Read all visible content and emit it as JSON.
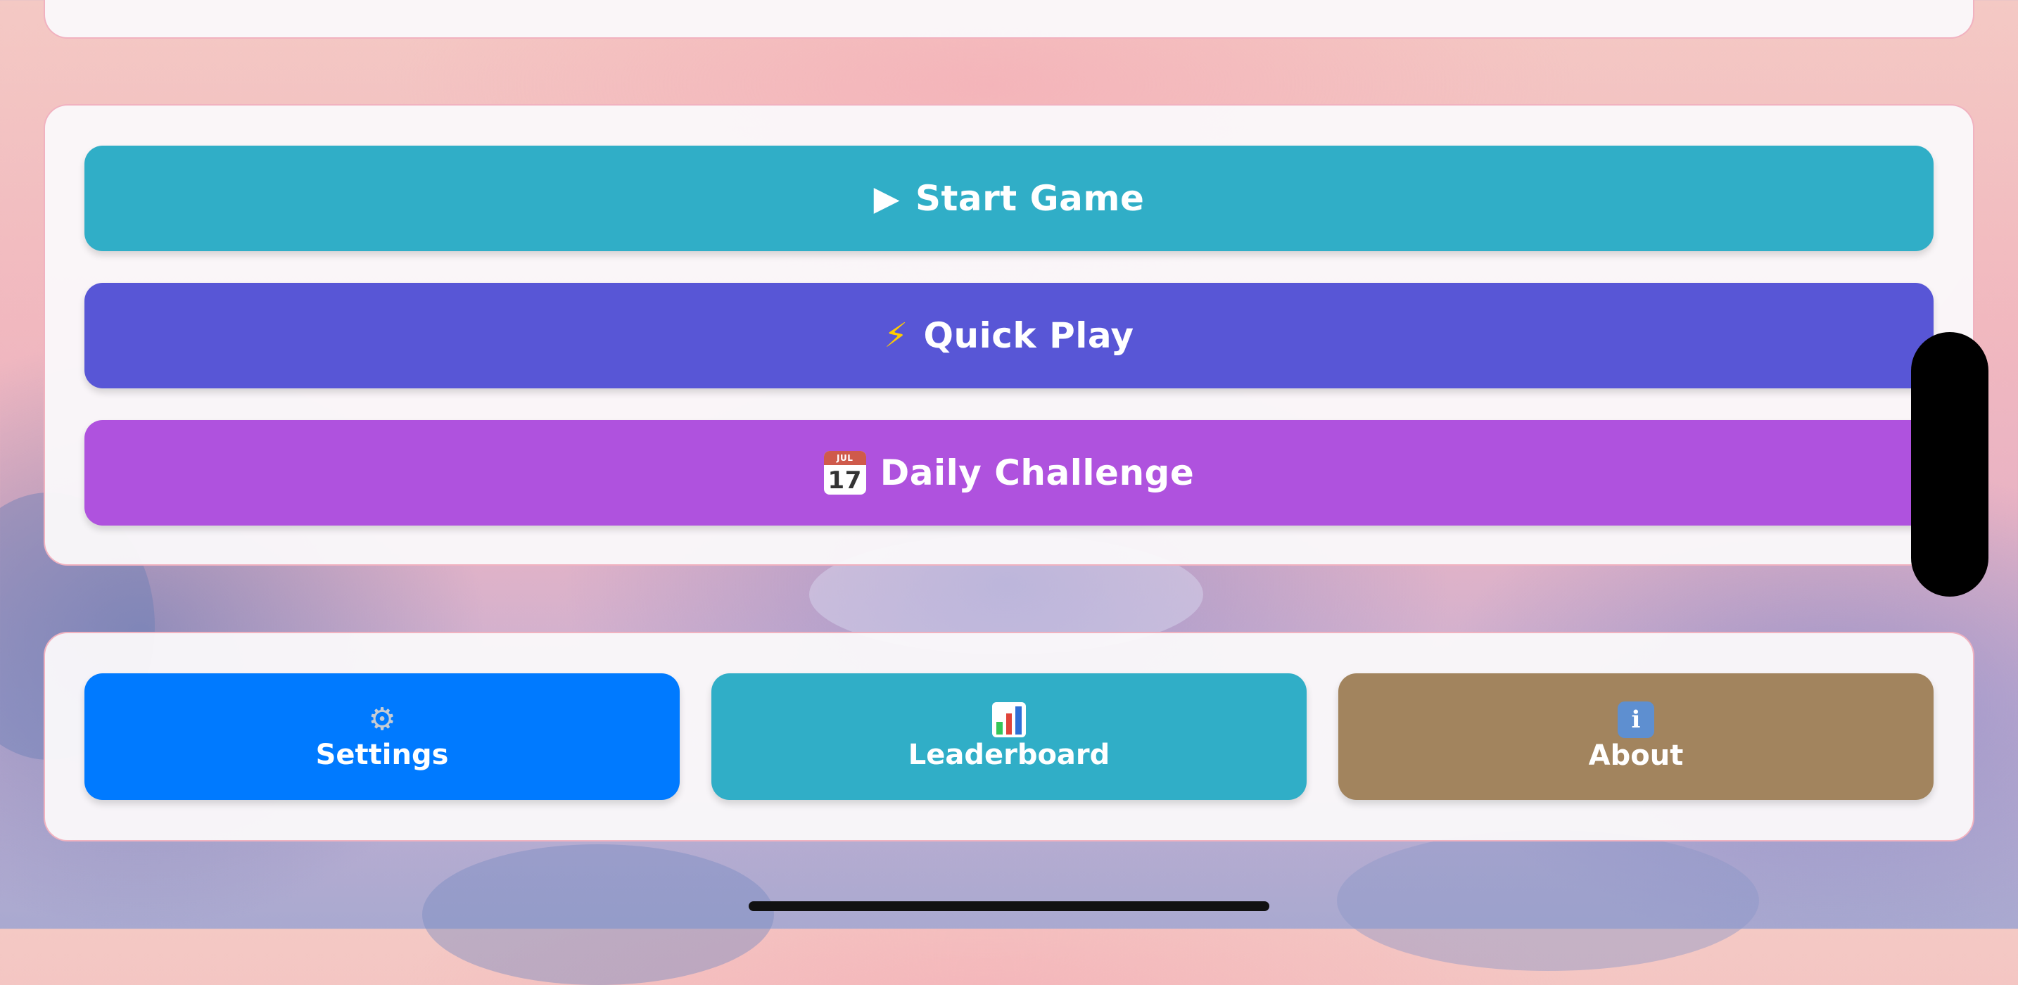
{
  "menu": {
    "start_game": {
      "icon": "play-icon",
      "glyph": "▶",
      "label": "Start Game",
      "color": "#30AEC7"
    },
    "quick_play": {
      "icon": "lightning-icon",
      "glyph": "⚡",
      "label": "Quick Play",
      "color": "#5856D6"
    },
    "daily_challenge": {
      "icon": "calendar-icon",
      "calendar_month": "JUL",
      "calendar_day": "17",
      "label": "Daily Challenge",
      "color": "#AF52DE"
    }
  },
  "nav": {
    "settings": {
      "icon": "gear-icon",
      "glyph": "⚙",
      "label": "Settings",
      "color": "#007AFF"
    },
    "leaderboard": {
      "icon": "bar-chart-icon",
      "label": "Leaderboard",
      "color": "#30AEC7"
    },
    "about": {
      "icon": "info-icon",
      "glyph": "i",
      "label": "About",
      "color": "#A2845E"
    }
  }
}
